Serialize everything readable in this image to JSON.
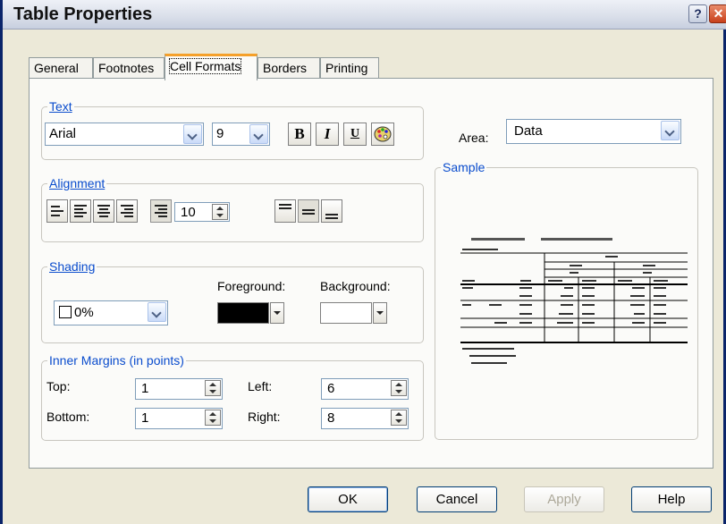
{
  "window": {
    "title": "Table Properties"
  },
  "tabs": [
    "General",
    "Footnotes",
    "Cell Formats",
    "Borders",
    "Printing"
  ],
  "active_tab": "Cell Formats",
  "text_group": {
    "legend": "Text",
    "font": "Arial",
    "size": "9",
    "bold": "B",
    "italic": "I",
    "underline": "U"
  },
  "area": {
    "label": "Area:",
    "value": "Data"
  },
  "alignment_group": {
    "legend": "Alignment",
    "indent_value": "10"
  },
  "shading_group": {
    "legend": "Shading",
    "percent": "0%",
    "foreground_label": "Foreground:",
    "background_label": "Background:",
    "foreground_color": "#000000",
    "background_color": "#ffffff"
  },
  "margins_group": {
    "legend": "Inner Margins (in points)",
    "top_label": "Top:",
    "top_value": "1",
    "bottom_label": "Bottom:",
    "bottom_value": "1",
    "left_label": "Left:",
    "left_value": "6",
    "right_label": "Right:",
    "right_value": "8"
  },
  "sample": {
    "legend": "Sample"
  },
  "buttons": {
    "ok": "OK",
    "cancel": "Cancel",
    "apply": "Apply",
    "help": "Help"
  }
}
